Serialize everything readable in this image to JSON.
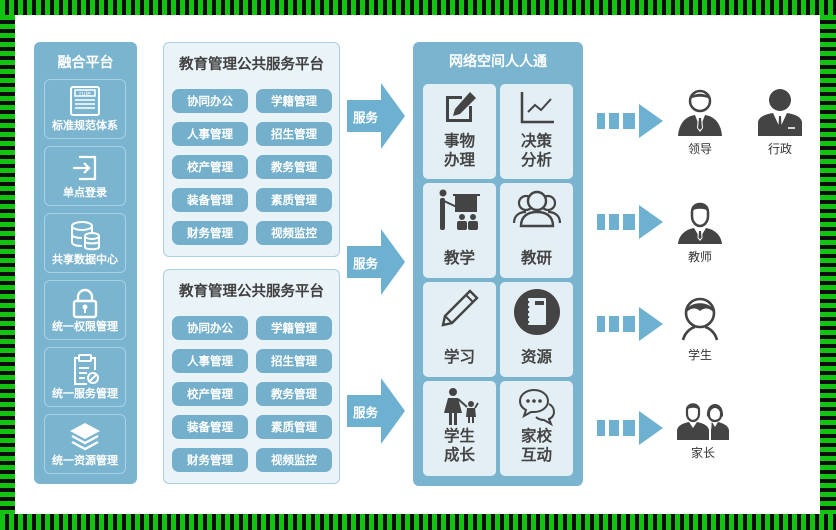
{
  "colors": {
    "frame_green": "#12c312",
    "panel_blue": "#7ab4cf",
    "pill_blue": "#74b0cb",
    "light_bg": "#eaf3f8",
    "icon_dark": "#4a4a4a",
    "arrow_blue": "#6db0cf"
  },
  "fusion_platform": {
    "title": "融合平台",
    "items": [
      {
        "icon": "rule-document-icon",
        "label": "标准规范体系"
      },
      {
        "icon": "login-icon",
        "label": "单点登录"
      },
      {
        "icon": "database-icon",
        "label": "共享数据中心"
      },
      {
        "icon": "lock-icon",
        "label": "统一权限管理"
      },
      {
        "icon": "clipboard-icon",
        "label": "统一服务管理"
      },
      {
        "icon": "layers-icon",
        "label": "统一资源管理"
      }
    ]
  },
  "edu_platforms": [
    {
      "title": "教育管理公共服务平台",
      "modules": [
        "协同办公",
        "学籍管理",
        "人事管理",
        "招生管理",
        "校产管理",
        "教务管理",
        "装备管理",
        "素质管理",
        "财务管理",
        "视频监控"
      ]
    },
    {
      "title": "教育管理公共服务平台",
      "modules": [
        "协同办公",
        "学籍管理",
        "人事管理",
        "招生管理",
        "校产管理",
        "教务管理",
        "装备管理",
        "素质管理",
        "财务管理",
        "视频监控"
      ]
    }
  ],
  "service_arrows": [
    "服务",
    "服务",
    "服务"
  ],
  "network_space": {
    "title": "网络空间人人通",
    "tiles": [
      {
        "icon": "edit-icon",
        "label": "事物\n办理"
      },
      {
        "icon": "line-chart-icon",
        "label": "决策\n分析"
      },
      {
        "icon": "teaching-icon",
        "label": "教学"
      },
      {
        "icon": "group-icon",
        "label": "教研"
      },
      {
        "icon": "pencil-icon",
        "label": "学习"
      },
      {
        "icon": "notebook-icon",
        "label": "资源"
      },
      {
        "icon": "parent-child-icon",
        "label": "学生\n成长"
      },
      {
        "icon": "chat-icon",
        "label": "家校\n互动"
      }
    ]
  },
  "users": [
    {
      "icon": "leader-icon",
      "label": "领导"
    },
    {
      "icon": "admin-icon",
      "label": "行政"
    },
    {
      "icon": "teacher-icon",
      "label": "教师"
    },
    {
      "icon": "student-icon",
      "label": "学生"
    },
    {
      "icon": "parents-icon",
      "label": "家长"
    }
  ]
}
